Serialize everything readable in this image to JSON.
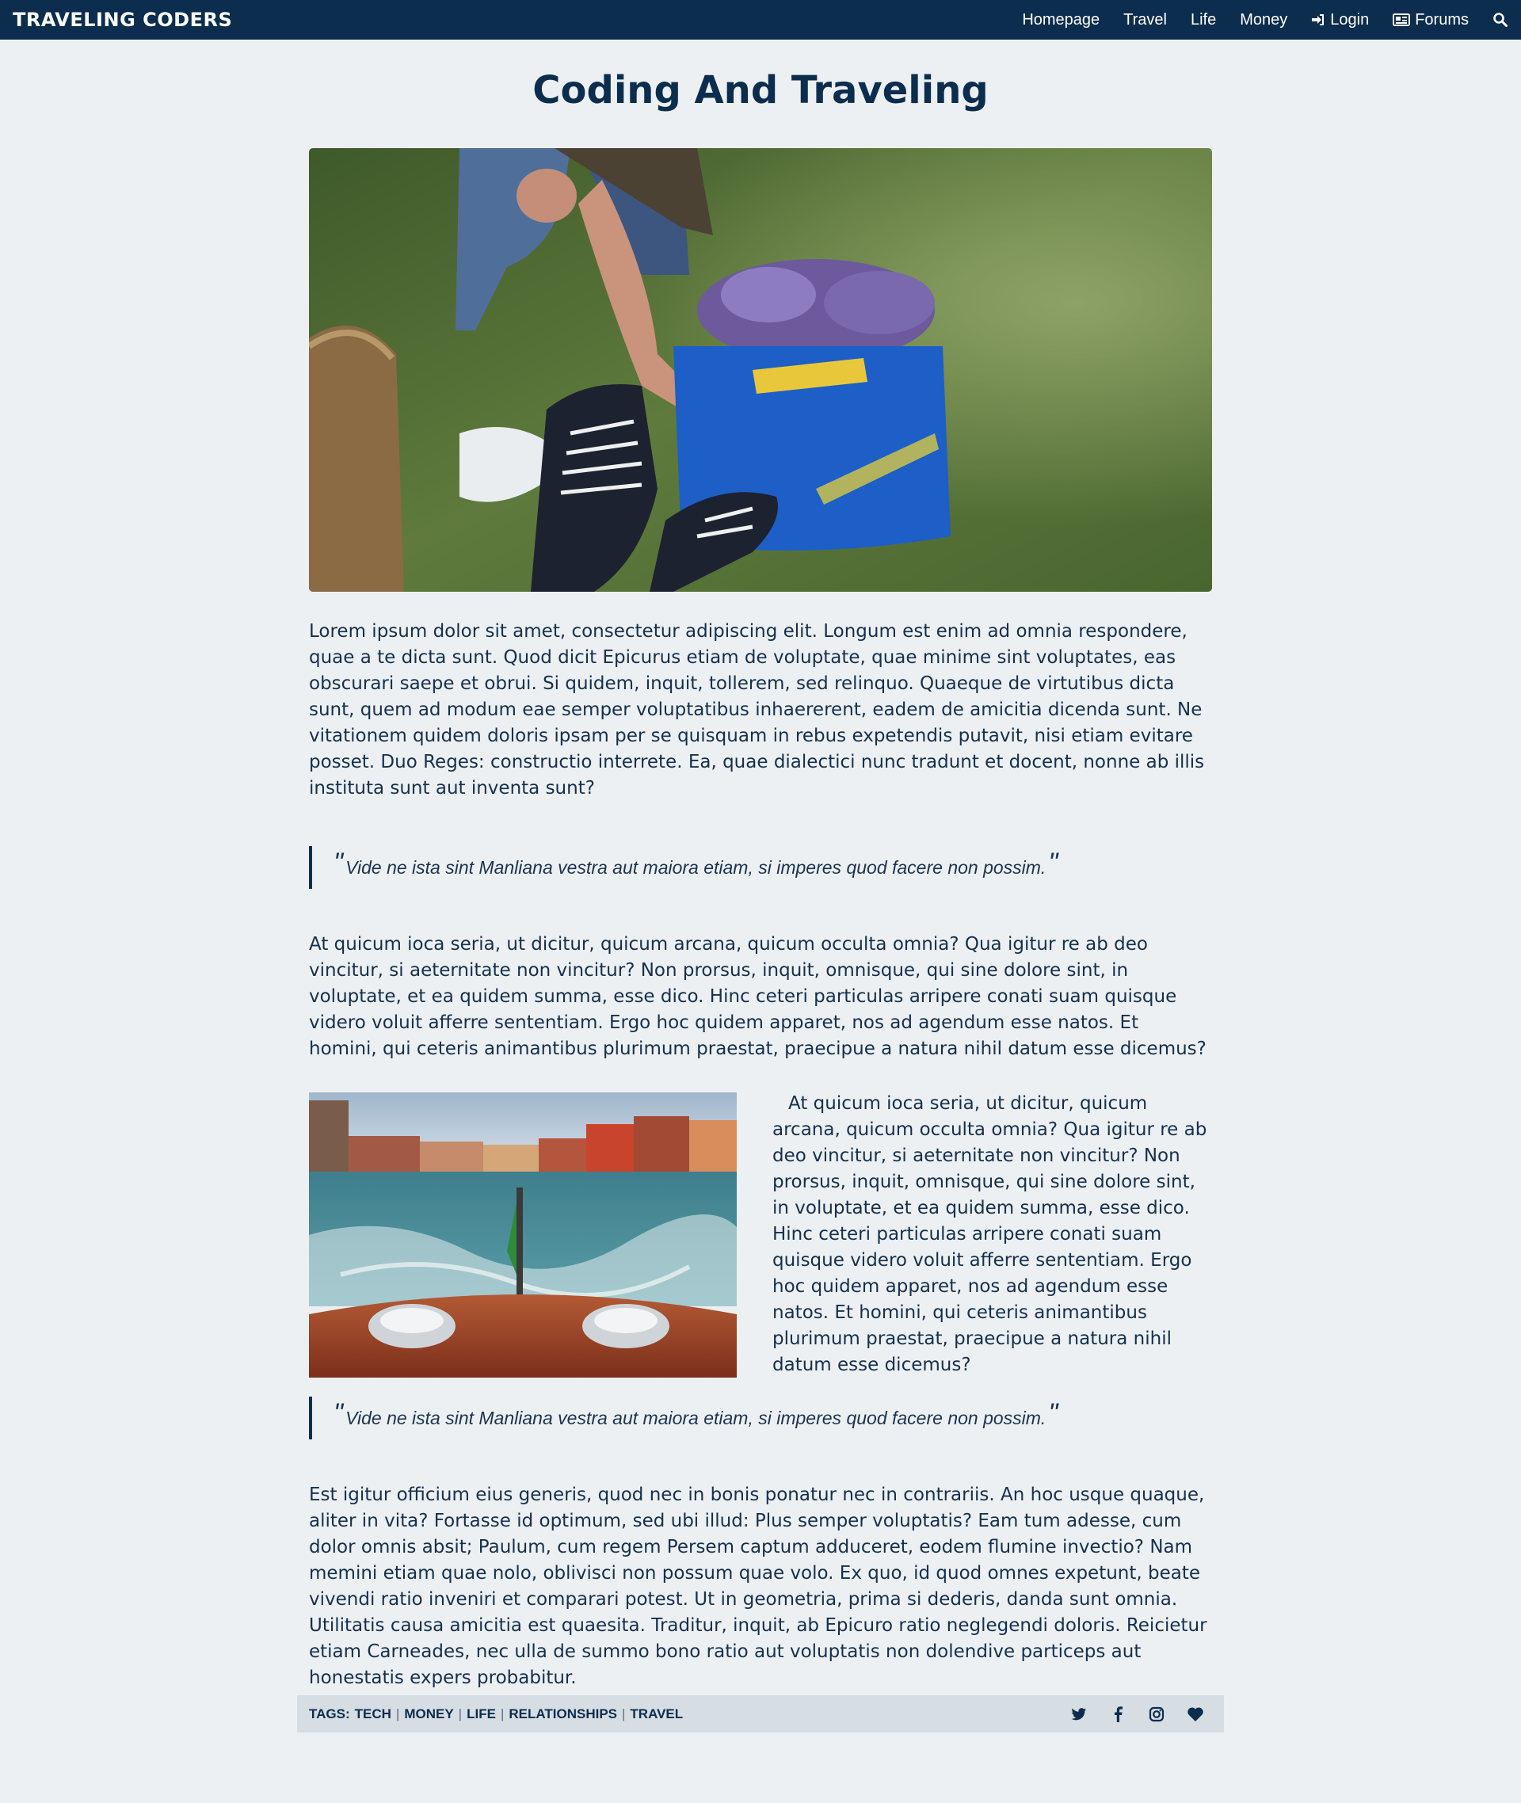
{
  "header": {
    "brand": "TRAVELING CODERS",
    "nav": {
      "homepage": "Homepage",
      "travel": "Travel",
      "life": "Life",
      "money": "Money",
      "login": "Login",
      "forums": "Forums"
    },
    "icons": [
      "sign-in-icon",
      "newspaper-icon",
      "search-icon"
    ]
  },
  "article": {
    "title": "Coding And Traveling",
    "p1": "Lorem ipsum dolor sit amet, consectetur adipiscing elit. Longum est enim ad omnia respondere, quae a te dicta sunt. Quod dicit Epicurus etiam de voluptate, quae minime sint voluptates, eas obscurari saepe et obrui. Si quidem, inquit, tollerem, sed relinquo. Quaeque de virtutibus dicta sunt, quem ad modum eae semper voluptatibus inhaererent, eadem de amicitia dicenda sunt. Ne vitationem quidem doloris ipsam per se quisquam in rebus expetendis putavit, nisi etiam evitare posset. Duo Reges: constructio interrete. Ea, quae dialectici nunc tradunt et docent, nonne ab illis instituta sunt aut inventa sunt?",
    "quote1": "Vide ne ista sint Manliana vestra aut maiora etiam, si imperes quod facere non possim.",
    "p2": "At quicum ioca seria, ut dicitur, quicum arcana, quicum occulta omnia? Qua igitur re ab deo vincitur, si aeternitate non vincitur? Non prorsus, inquit, omnisque, qui sine dolore sint, in voluptate, et ea quidem summa, esse dico. Hinc ceteri particulas arripere conati suam quisque videro voluit afferre sententiam. Ergo hoc quidem apparet, nos ad agendum esse natos. Et homini, qui ceteris animantibus plurimum praestat, praecipue a natura nihil datum esse dicemus?",
    "p3": "At quicum ioca seria, ut dicitur, quicum arcana, quicum occulta omnia? Qua igitur re ab deo vincitur, si aeternitate non vincitur? Non prorsus, inquit, omnisque, qui sine dolore sint, in voluptate, et ea quidem summa, esse dico. Hinc ceteri particulas arripere conati suam quisque videro voluit afferre sententiam. Ergo hoc quidem apparet, nos ad agendum esse natos. Et homini, qui ceteris animantibus plurimum praestat, praecipue a natura nihil datum esse dicemus?",
    "quote2": "Vide ne ista sint Manliana vestra aut maiora etiam, si imperes quod facere non possim.",
    "p4": "Est igitur officium eius generis, quod nec in bonis ponatur nec in contrariis. An hoc usque quaque, aliter in vita? Fortasse id optimum, sed ubi illud: Plus semper voluptatis? Eam tum adesse, cum dolor omnis absit; Paulum, cum regem Persem captum adduceret, eodem flumine invectio? Nam memini etiam quae nolo, oblivisci non possum quae volo. Ex quo, id quod omnes expetunt, beate vivendi ratio inveniri et comparari potest. Ut in geometria, prima si dederis, danda sunt omnia. Utilitatis causa amicitia est quaesita. Traditur, inquit, ab Epicuro ratio neglegendi doloris. Reicietur etiam Carneades, nec ulla de summo bono ratio aut voluptatis non dolendive particeps aut honestatis expers probabitur.",
    "quote_mark": "\""
  },
  "footer": {
    "tags_label": "TAGS:",
    "tags": [
      "TECH",
      "MONEY",
      "LIFE",
      "RELATIONSHIPS",
      "TRAVEL"
    ],
    "separator": "|",
    "social_icons": [
      "twitter-icon",
      "facebook-icon",
      "instagram-icon",
      "heart-icon"
    ]
  },
  "colors": {
    "navbar": "#0c2d4d",
    "background": "#edf0f2",
    "footer_bar": "#d6dde3",
    "text": "#15304d"
  }
}
